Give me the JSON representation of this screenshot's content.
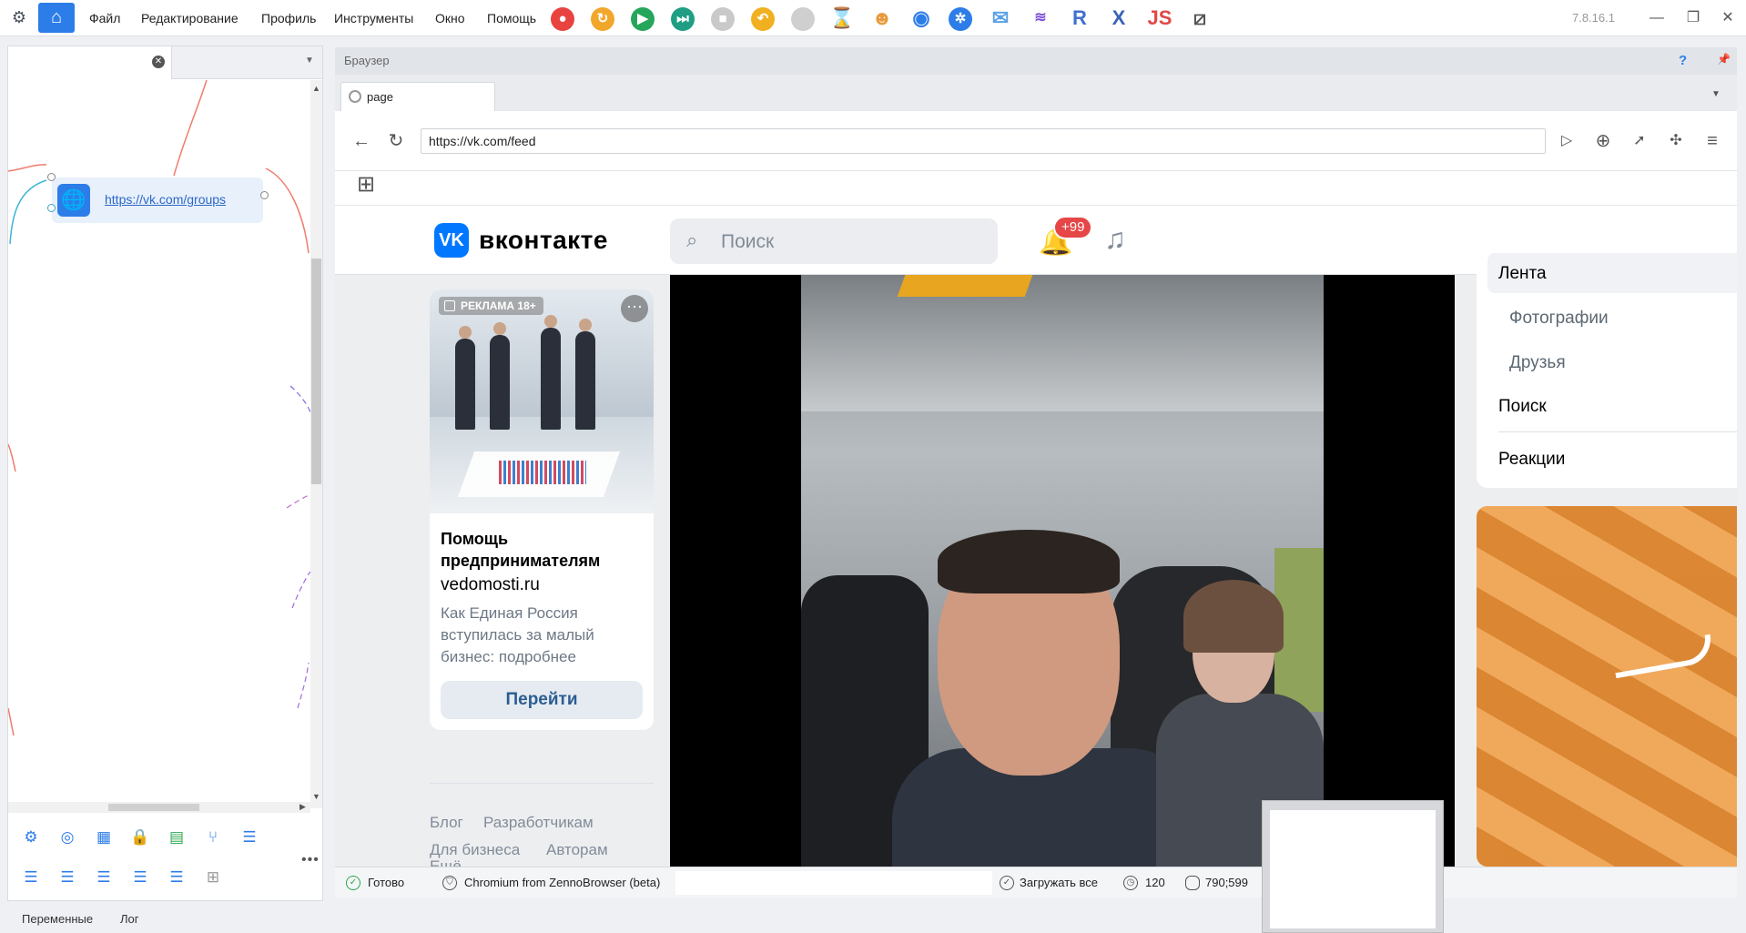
{
  "menubar": {
    "items": [
      "Файл",
      "Редактирование",
      "Профиль",
      "Инструменты",
      "Окно",
      "Помощь"
    ],
    "version": "7.8.16.1",
    "toolbar_glyphs": {
      "r": "R",
      "x": "X",
      "js": "JS"
    }
  },
  "left_panel": {
    "node_url": "https://vk.com/groups"
  },
  "bottom_tabs": [
    "Переменные",
    "Лог"
  ],
  "browser": {
    "pane_title": "Браузер",
    "help": "?",
    "tab_label": "page",
    "address": "https://vk.com/feed"
  },
  "vk": {
    "brand": "вконтакте",
    "logo_letter": "VK",
    "search_placeholder": "Поиск",
    "notif_badge": "+99",
    "ad": {
      "label": "РЕКЛАМА  18+",
      "title": "Помощь предпринимателям",
      "domain": "vedomosti.ru",
      "description": "Как Единая Россия вступилась за малый бизнес: подробнее",
      "button": "Перейти"
    },
    "footer_links": [
      "Блог",
      "Разработчикам",
      "Для бизнеса",
      "Авторам",
      "Ещё"
    ],
    "right_nav": [
      "Лента",
      "Фотографии",
      "Друзья",
      "Поиск",
      "Реакции"
    ]
  },
  "status_bar": {
    "ready": "Готово",
    "engine": "Chromium from ZennoBrowser (beta)",
    "load_all": "Загружать все",
    "timeout": "120",
    "coords": "790;599"
  },
  "colors": {
    "accent": "#2d7de8",
    "vk_blue": "#0077ff",
    "badge_red": "#e64646"
  }
}
